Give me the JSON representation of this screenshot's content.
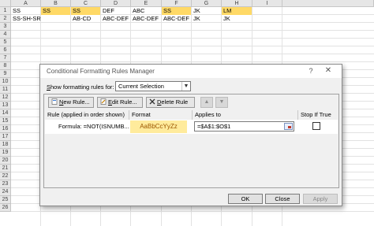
{
  "sheet": {
    "columns": [
      "A",
      "B",
      "C",
      "D",
      "E",
      "F",
      "G",
      "H",
      "I"
    ],
    "rows": [
      "1",
      "2",
      "3",
      "4",
      "5",
      "6",
      "7",
      "8",
      "9",
      "10",
      "11",
      "12",
      "13",
      "14",
      "15",
      "16",
      "17",
      "18",
      "19",
      "20",
      "21",
      "22",
      "23",
      "24",
      "25",
      "26"
    ],
    "row1": [
      "SS",
      "SS",
      "SS",
      "DEF",
      "ABC",
      "SS",
      "JK",
      "LM",
      ""
    ],
    "row2": [
      "SS-SH-SR",
      "",
      "AB-CD",
      "ABC-DEF",
      "ABC-DEF",
      "ABC-DEF",
      "JK",
      "JK",
      ""
    ],
    "highlight_color": "#ffd966"
  },
  "dialog": {
    "title": "Conditional Formatting Rules Manager",
    "help": "?",
    "close": "✕",
    "show_rules_label_pre": "",
    "show_rules_label_u": "S",
    "show_rules_label_post": "how formatting rules for:",
    "scope_value": "Current Selection",
    "toolbar": {
      "new_rule_u": "N",
      "new_rule_rest": "ew Rule...",
      "edit_rule_u": "E",
      "edit_rule_rest": "dit Rule...",
      "delete_rule_u": "D",
      "delete_rule_rest": "elete Rule",
      "move_up": "▲",
      "move_down": "▼"
    },
    "headers": {
      "rule": "Rule (applied in order shown)",
      "format": "Format",
      "applies": "Applies to",
      "stop": "Stop If True"
    },
    "rule": {
      "description": "Formula: =NOT(ISNUMB...",
      "format_preview": "AaBbCcYyZz",
      "applies_to": "=$A$1:$O$1",
      "stop_if_true": false
    },
    "buttons": {
      "ok": "OK",
      "close": "Close",
      "apply": "Apply"
    }
  }
}
